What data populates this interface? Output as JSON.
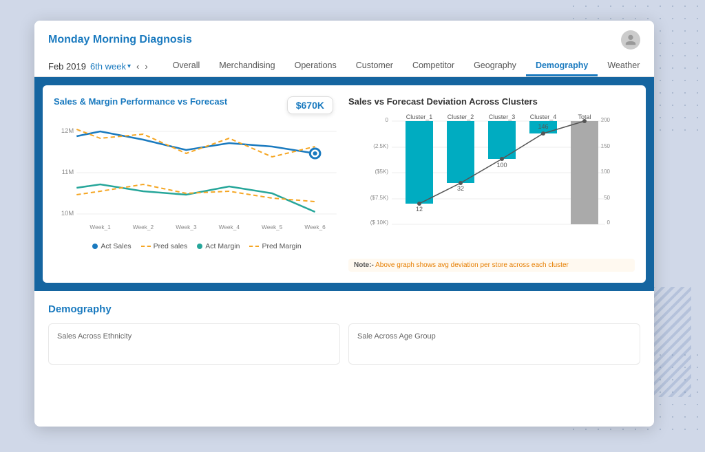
{
  "app": {
    "title": "Monday Morning Diagnosis"
  },
  "header": {
    "date": "Feb 2019",
    "week": "6th week",
    "tabs": [
      {
        "label": "Overall",
        "active": false
      },
      {
        "label": "Merchandising",
        "active": false
      },
      {
        "label": "Operations",
        "active": false
      },
      {
        "label": "Customer",
        "active": false
      },
      {
        "label": "Competitor",
        "active": false
      },
      {
        "label": "Geography",
        "active": false
      },
      {
        "label": "Demography",
        "active": true
      },
      {
        "label": "Weather",
        "active": false
      }
    ]
  },
  "left_chart": {
    "title": "Sales & Margin Performance vs Forecast",
    "price_badge": "$670K",
    "x_labels": [
      "Week_1",
      "Week_2",
      "Week_3",
      "Week_4",
      "Week_5",
      "Week_6"
    ],
    "y_labels": [
      "12M",
      "11M",
      "10M"
    ],
    "legend": [
      {
        "label": "Act Sales",
        "type": "dot",
        "color": "#1a7abf"
      },
      {
        "label": "Pred sales",
        "type": "dash",
        "color": "#f5a623"
      },
      {
        "label": "Act Margin",
        "type": "dot",
        "color": "#26a69a"
      },
      {
        "label": "Pred Margin",
        "type": "dash",
        "color": "#f5a623"
      }
    ]
  },
  "right_chart": {
    "title": "Sales vs Forecast Deviation Across  Clusters",
    "clusters": [
      "Cluster_1",
      "Cluster_2",
      "Cluster_3",
      "Cluster_4",
      "Total"
    ],
    "values": [
      12,
      32,
      100,
      146,
      200
    ],
    "note_label": "Note:-",
    "note_text": "Above graph shows avg deviation per store across each cluster"
  },
  "demography": {
    "title": "Demography",
    "cards": [
      {
        "subtitle": "Sales Across Ethnicity"
      },
      {
        "subtitle": "Sale Across Age Group"
      }
    ]
  },
  "colors": {
    "accent_blue": "#1a7abf",
    "teal": "#26a69a",
    "orange": "#f5a623",
    "bar_teal": "#00acc1",
    "bar_gray": "#aaa"
  }
}
